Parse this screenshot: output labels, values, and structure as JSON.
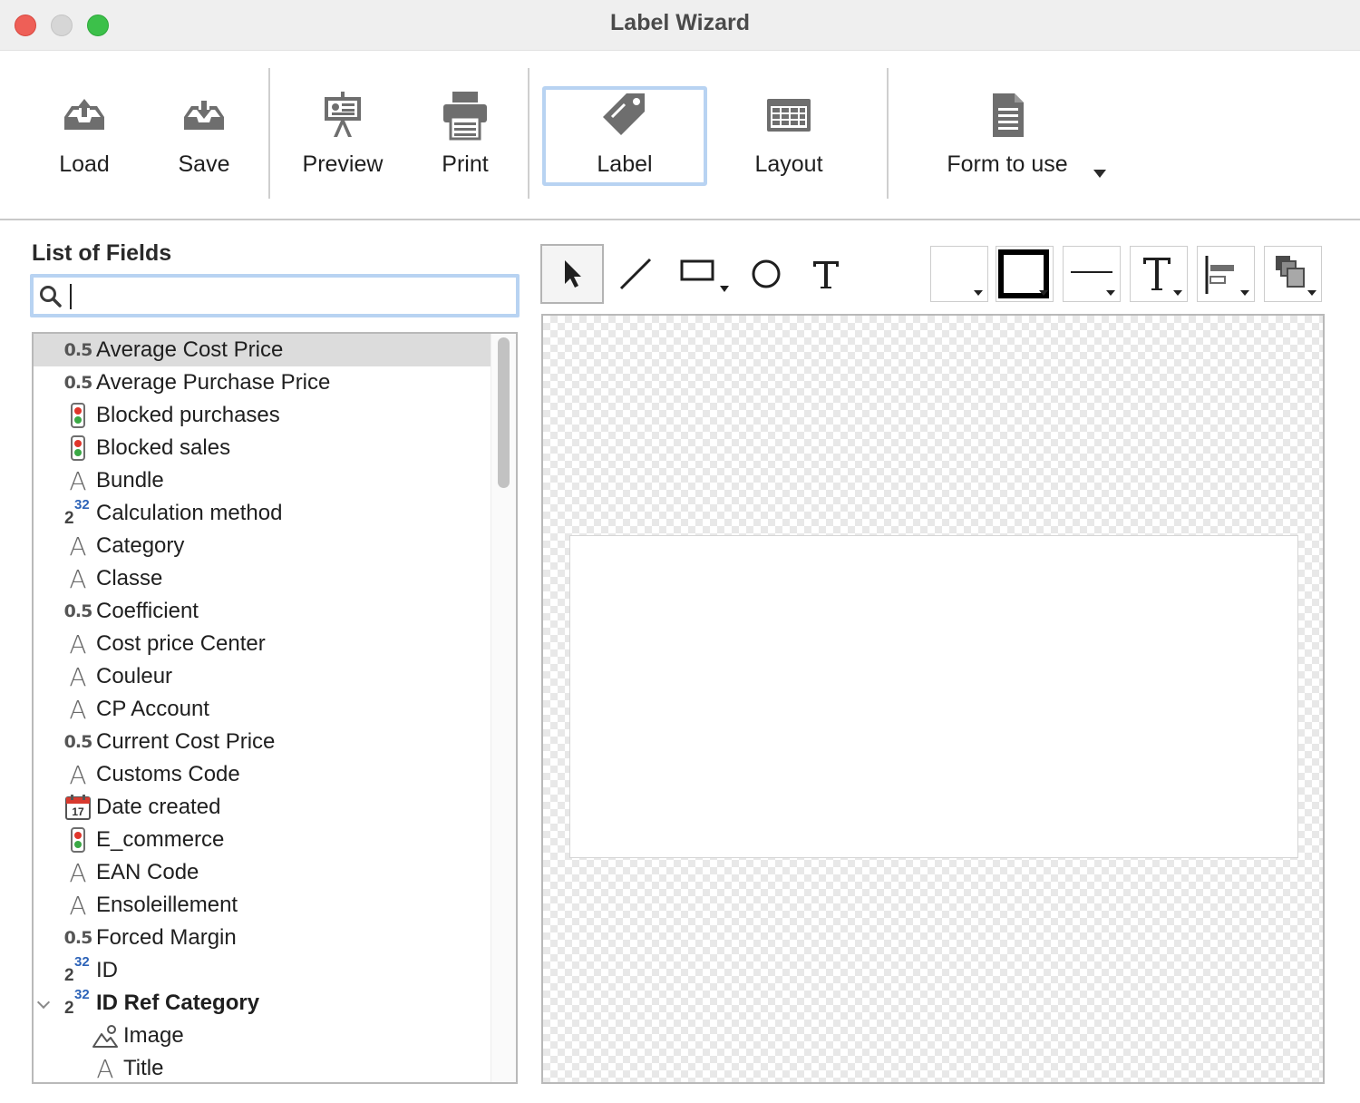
{
  "window": {
    "title": "Label Wizard"
  },
  "toolbar": {
    "load": "Load",
    "save": "Save",
    "preview": "Preview",
    "print": "Print",
    "label": "Label",
    "layout": "Layout",
    "form_to_use": "Form to use",
    "selected": "Label"
  },
  "fields_panel": {
    "title": "List of Fields",
    "search": {
      "value": "",
      "placeholder": ""
    },
    "items": [
      {
        "label": "Average Cost Price",
        "type": "decimal",
        "icon_text": "0.5",
        "selected": true
      },
      {
        "label": "Average Purchase Price",
        "type": "decimal",
        "icon_text": "0.5"
      },
      {
        "label": "Blocked purchases",
        "type": "boolean"
      },
      {
        "label": "Blocked sales",
        "type": "boolean"
      },
      {
        "label": "Bundle",
        "type": "text",
        "icon_text": "A"
      },
      {
        "label": "Calculation method",
        "type": "integer",
        "icon_text": "2",
        "icon_exp": "32"
      },
      {
        "label": "Category",
        "type": "text",
        "icon_text": "A"
      },
      {
        "label": "Classe",
        "type": "text",
        "icon_text": "A"
      },
      {
        "label": "Coefficient",
        "type": "decimal",
        "icon_text": "0.5"
      },
      {
        "label": "Cost price Center",
        "type": "text",
        "icon_text": "A"
      },
      {
        "label": "Couleur",
        "type": "text",
        "icon_text": "A"
      },
      {
        "label": "CP Account",
        "type": "text",
        "icon_text": "A"
      },
      {
        "label": "Current Cost Price",
        "type": "decimal",
        "icon_text": "0.5"
      },
      {
        "label": "Customs Code",
        "type": "text",
        "icon_text": "A"
      },
      {
        "label": "Date created",
        "type": "date",
        "icon_text": "17"
      },
      {
        "label": "E_commerce",
        "type": "boolean"
      },
      {
        "label": "EAN Code",
        "type": "text",
        "icon_text": "A"
      },
      {
        "label": "Ensoleillement",
        "type": "text",
        "icon_text": "A"
      },
      {
        "label": "Forced Margin",
        "type": "decimal",
        "icon_text": "0.5"
      },
      {
        "label": "ID",
        "type": "integer",
        "icon_text": "2",
        "icon_exp": "32"
      },
      {
        "label": "ID Ref Category",
        "type": "integer",
        "icon_text": "2",
        "icon_exp": "32",
        "bold": true,
        "expanded": true
      },
      {
        "label": "Image",
        "type": "picture",
        "child": true
      },
      {
        "label": "Title",
        "type": "text",
        "icon_text": "A",
        "child": true
      }
    ]
  },
  "drawing_tools": [
    "select-arrow",
    "line",
    "rectangle",
    "oval",
    "text"
  ],
  "format_tools": [
    "fill-color",
    "stroke-color",
    "line-width",
    "font",
    "align",
    "arrange"
  ],
  "colors": {
    "selection": "#b8d3f2",
    "row_selected": "#dcdcdc"
  }
}
